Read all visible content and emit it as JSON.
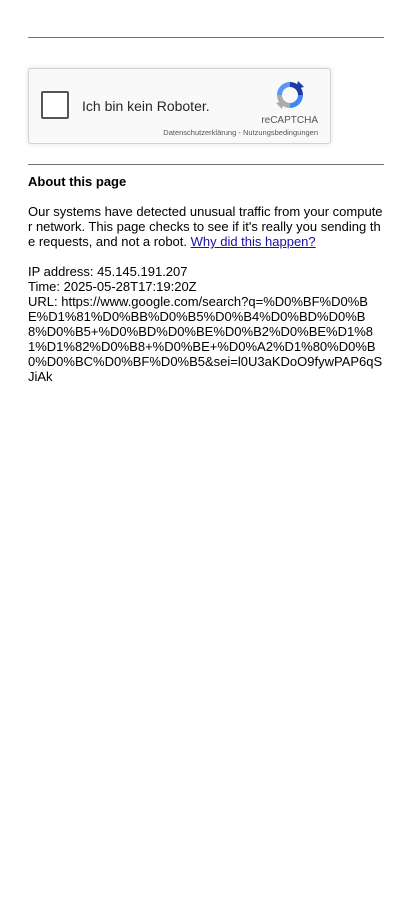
{
  "captcha": {
    "checkbox_label": "Ich bin kein Roboter.",
    "brand": "reCAPTCHA",
    "privacy_link": "Datenschutzerklärung",
    "separator": " - ",
    "terms_link": "Nutzungsbedingungen"
  },
  "about": {
    "title": "About this page",
    "body": "Our systems have detected unusual traffic from your computer network. This page checks to see if it's really you sending the requests, and not a robot. ",
    "why_link": "Why did this happen?"
  },
  "details": {
    "ip": "IP address: 45.145.191.207",
    "time": "Time: 2025-05-28T17:19:20Z",
    "url": "URL: https://www.google.com/search?q=%D0%BF%D0%BE%D1%81%D0%BB%D0%B5%D0%B4%D0%BD%D0%B8%D0%B5+%D0%BD%D0%BE%D0%B2%D0%BE%D1%81%D1%82%D0%B8+%D0%BE+%D0%A2%D1%80%D0%B0%D0%BC%D0%BF%D0%B5&sei=l0U3aKDoO9fywPAP6qSJiAk"
  }
}
